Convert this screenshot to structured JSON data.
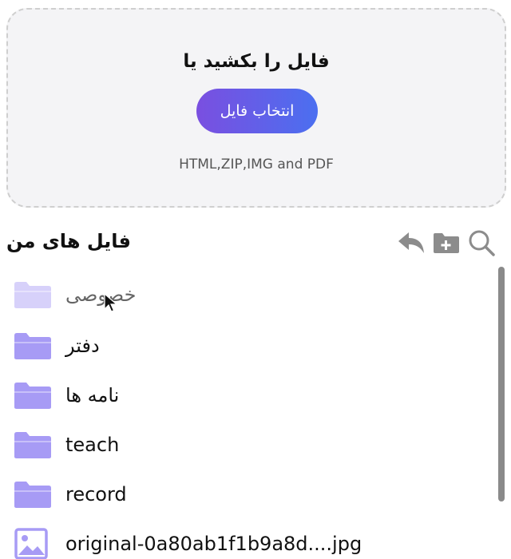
{
  "upload": {
    "title": "فایل را بکشید یا",
    "button_label": "انتخاب فایل",
    "formats": "HTML,ZIP,IMG and PDF"
  },
  "header": {
    "title": "فایل های من",
    "tools": [
      "back-icon",
      "new-folder-icon",
      "search-icon"
    ]
  },
  "files": [
    {
      "name": "خصوصی",
      "type": "folder",
      "state": "dimmed"
    },
    {
      "name": "دفتر",
      "type": "folder"
    },
    {
      "name": "نامه ها",
      "type": "folder"
    },
    {
      "name": "teach",
      "type": "folder"
    },
    {
      "name": "record",
      "type": "folder"
    },
    {
      "name": "original-0a80ab1f1b9a8d....jpg",
      "type": "image"
    }
  ],
  "colors": {
    "folder": "#a79bf5",
    "button_start": "#7a4fe0",
    "button_end": "#4b6ff0",
    "upload_bg": "#f4f4f6",
    "icon_gray": "#8c8c8c"
  }
}
